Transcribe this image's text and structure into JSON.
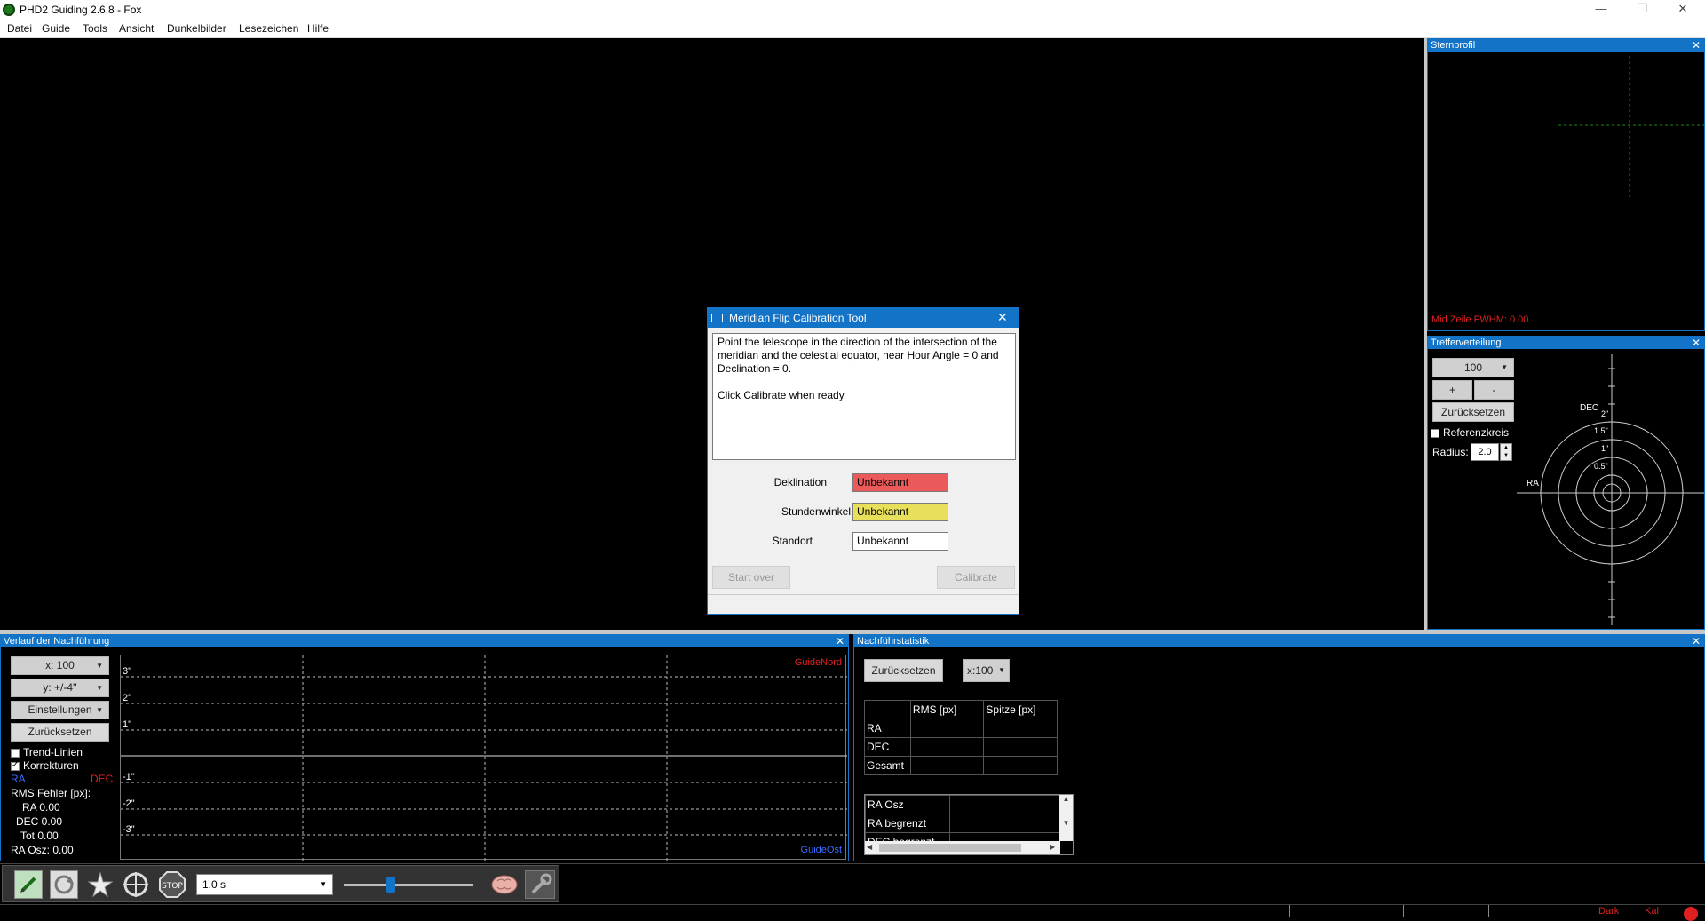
{
  "window": {
    "title": "PHD2 Guiding 2.6.8 - Fox",
    "min": "—",
    "max": "❐",
    "close": "✕"
  },
  "menu": [
    "Datei",
    "Guide",
    "Tools",
    "Ansicht",
    "Dunkelbilder",
    "Lesezeichen",
    "Hilfe"
  ],
  "star_profile": {
    "title": "Sternprofil",
    "fwhm": "Mid Zeile FWHM: 0.00"
  },
  "target": {
    "title": "Trefferverteilung",
    "zoom": "100",
    "plus": "+",
    "minus": "-",
    "reset": "Zurücksetzen",
    "reference_label": "Referenzkreis",
    "radius_label": "Radius:",
    "radius_value": "2.0",
    "dec_label": "DEC",
    "ra_label": "RA",
    "ring_labels": [
      "2\"",
      "1.5\"",
      "1\"",
      "0.5\""
    ]
  },
  "dialog": {
    "title": "Meridian Flip Calibration Tool",
    "message": "Point the telescope in the direction of the intersection of the meridian and the celestial equator, near Hour Angle = 0 and Declination = 0.\n\nClick Calibrate when ready.",
    "declination_label": "Deklination",
    "declination_value": "Unbekannt",
    "declination_color": "#ea5a5a",
    "hour_angle_label": "Stundenwinkel",
    "hour_angle_value": "Unbekannt",
    "hour_angle_color": "#e8e05a",
    "location_label": "Standort",
    "location_value": "Unbekannt",
    "start_over": "Start over",
    "calibrate": "Calibrate"
  },
  "history": {
    "title": "Verlauf der Nachführung",
    "x_scale": "x: 100",
    "y_scale": "y: +/-4''",
    "settings": "Einstellungen",
    "reset": "Zurücksetzen",
    "trend_lines": "Trend-Linien",
    "corrections": "Korrekturen",
    "ra_legend": "RA",
    "dec_legend": "DEC",
    "rms_title": "RMS Fehler [px]:",
    "rms_ra": "RA 0.00",
    "rms_dec": "DEC 0.00",
    "rms_tot": "Tot 0.00",
    "ra_osc": "RA Osz: 0.00",
    "guide_north": "GuideNord",
    "guide_east": "GuideOst",
    "y_labels": [
      "3\"",
      "2\"",
      "1\"",
      "-1\"",
      "-2\"",
      "-3\""
    ],
    "ra_color": "#3b6cff",
    "dec_color": "#e02020"
  },
  "stats": {
    "title": "Nachführstatistik",
    "reset": "Zurücksetzen",
    "x_scale": "x:100",
    "headers": [
      "",
      "RMS [px]",
      "Spitze [px]"
    ],
    "rows": [
      "RA",
      "DEC",
      "Gesamt"
    ],
    "list": [
      "RA Osz",
      "RA begrenzt",
      "DEC begrenzt"
    ]
  },
  "toolbar": {
    "exposure": "1.0 s",
    "icons": [
      "pencil-icon",
      "loop-icon",
      "star-select-icon",
      "guide-target-icon",
      "stop-icon",
      "brain-icon",
      "wrench-icon"
    ]
  },
  "statusbar": {
    "dark": "Dark",
    "cal": "Kal"
  }
}
